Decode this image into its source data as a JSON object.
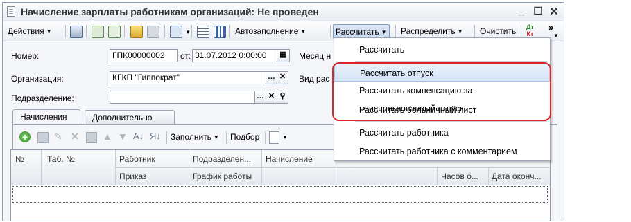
{
  "window": {
    "title": "Начисление зарплаты работникам организаций: Не проведен",
    "controls": [
      "_",
      "☐",
      "✕"
    ]
  },
  "toolbar": {
    "actions": "Действия",
    "autofill": "Автозаполнение",
    "calculate": "Рассчитать",
    "distribute": "Распределить",
    "clear": "Очистить",
    "dtkt_top": "Дт",
    "dtkt_bottom": "Кт",
    "more": "»"
  },
  "form": {
    "number_label": "Номер:",
    "number_value": "ГПК00000002",
    "date_label": "от:",
    "date_value": "31.07.2012  0:00:00",
    "month_label": "Месяц н",
    "org_label": "Организация:",
    "org_value": "КГКП \"Гиппократ\"",
    "calc_type_label": "Вид рас",
    "dept_label": "Подразделение:",
    "dept_value": ""
  },
  "tabs": [
    "Начисления",
    "Дополнительно"
  ],
  "grid_toolbar": {
    "fill": "Заполнить",
    "select": "Подбор"
  },
  "grid": {
    "headers_row1": [
      "№",
      "Таб. №",
      "Работник",
      "Подразделен...",
      "Начисление"
    ],
    "headers_row2": [
      "Приказ",
      "График работы",
      "Часов о...",
      "Дата оконч..."
    ]
  },
  "menu": {
    "items": [
      "Рассчитать",
      "Рассчитать отпуск",
      "Рассчитать компенсацию за неиспользованный отпуск",
      "Рассчитать больничный лист",
      "Рассчитать работника",
      "Рассчитать работника с комментарием"
    ]
  }
}
